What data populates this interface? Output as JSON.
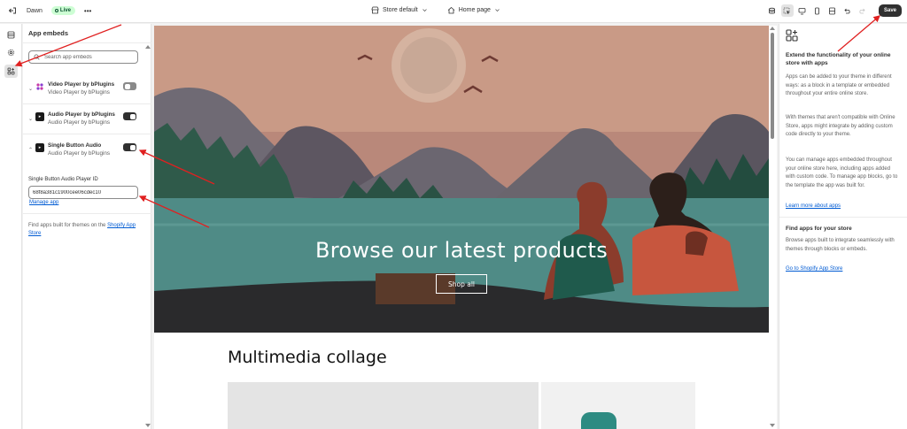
{
  "topbar": {
    "theme_name": "Dawn",
    "live_badge": "Live",
    "more": "•••",
    "store_select": "Store default",
    "page_select": "Home page",
    "save_label": "Save"
  },
  "left_panel": {
    "title": "App embeds",
    "search_placeholder": "Search app embeds",
    "embeds": [
      {
        "name": "Video Player by bPlugins",
        "subtitle": "Video Player by bPlugins",
        "enabled": false
      },
      {
        "name": "Audio Player by bPlugins",
        "subtitle": "Audio Player by bPlugins",
        "enabled": true
      },
      {
        "name": "Single Button Audio",
        "subtitle": "Audio Player by bPlugins",
        "enabled": true
      }
    ],
    "field_label": "Single Button Audio Player ID",
    "field_value": "68f8a381c1900cee06cdec10",
    "manage_link": "Manage app",
    "find_text": "Find apps built for themes on the",
    "find_link": "Shopify App Store"
  },
  "preview": {
    "hero_heading": "Browse our latest products",
    "shop_button": "Shop all",
    "collage_title": "Multimedia collage"
  },
  "right_panel": {
    "title": "Extend the functionality of your online store with apps",
    "p1": "Apps can be added to your theme in different ways: as a block in a template or embedded throughout your entire online store.",
    "p2": "With themes that aren't compatible with Online Store, apps might integrate by adding custom code directly to your theme.",
    "p3": "You can manage apps embedded throughout your online store here, including apps added with custom code. To manage app blocks, go to the template the app was built for.",
    "learn_link": "Learn more about apps",
    "find_title": "Find apps for your store",
    "find_p": "Browse apps built to integrate seamlessly with themes through blocks or embeds.",
    "store_link": "Go to Shopify App Store"
  },
  "colors": {
    "accent_link": "#005bd3",
    "live_badge_bg": "#cdfed4",
    "save_button_bg": "#303030",
    "annotation_arrow": "#e02020"
  }
}
